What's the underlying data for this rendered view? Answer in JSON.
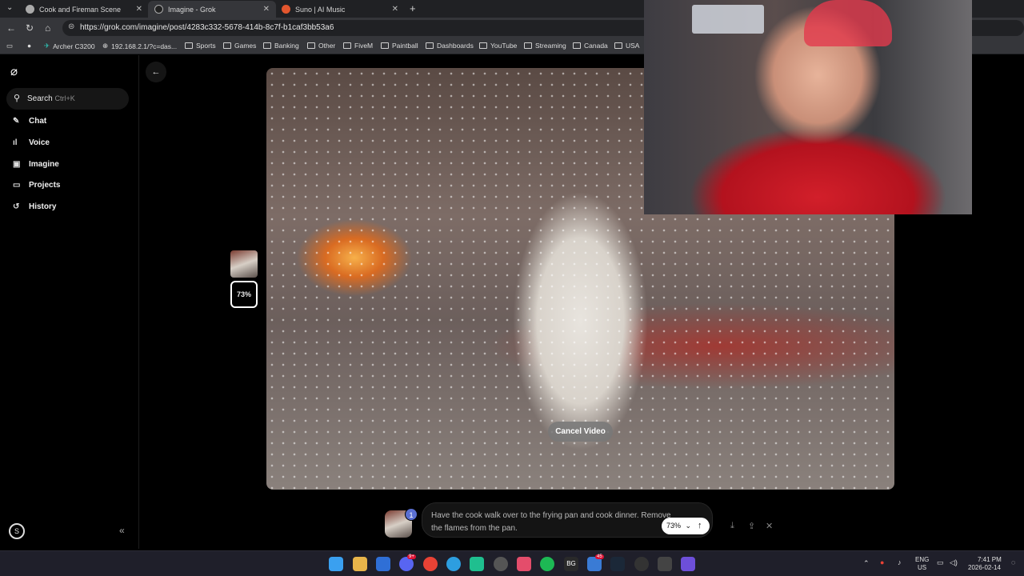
{
  "browser": {
    "tabs": [
      {
        "title": "Cook and Fireman Scene",
        "favicon_color": "#aaaaaa"
      },
      {
        "title": "Imagine - Grok",
        "favicon_color": "#222222"
      },
      {
        "title": "Suno | AI Music",
        "favicon_color": "#e2562e"
      }
    ],
    "url": "https://grok.com/imagine/post/4283c332-5678-414b-8c7f-b1caf3bb53a6",
    "bookmarks": [
      "Archer C3200",
      "192.168.2.1/?c=das...",
      "Sports",
      "Games",
      "Banking",
      "Other",
      "FiveM",
      "Paintball",
      "Dashboards",
      "YouTube",
      "Streaming",
      "Canada",
      "USA"
    ]
  },
  "sidebar": {
    "search_label": "Search",
    "search_shortcut": "Ctrl+K",
    "items": [
      {
        "label": "Chat",
        "icon": "pencil-icon"
      },
      {
        "label": "Voice",
        "icon": "waveform-icon"
      },
      {
        "label": "Imagine",
        "icon": "imagine-icon"
      },
      {
        "label": "Projects",
        "icon": "folder-icon"
      },
      {
        "label": "History",
        "icon": "history-icon"
      }
    ],
    "avatar_initial": "S"
  },
  "main": {
    "cancel_button": "Cancel Video",
    "progress_label": "73%",
    "progress": 0.73,
    "prompt_text": "Have the cook walk over to the frying pan and cook dinner. Remove the flames from the pan.",
    "percent_button": "73%",
    "reference_badge": "1"
  },
  "taskbar": {
    "lang_top": "ENG",
    "lang_bottom": "US",
    "time": "7:41 PM",
    "date": "2026-02-14",
    "badge_discord": "9+",
    "badge_mail": "45"
  }
}
